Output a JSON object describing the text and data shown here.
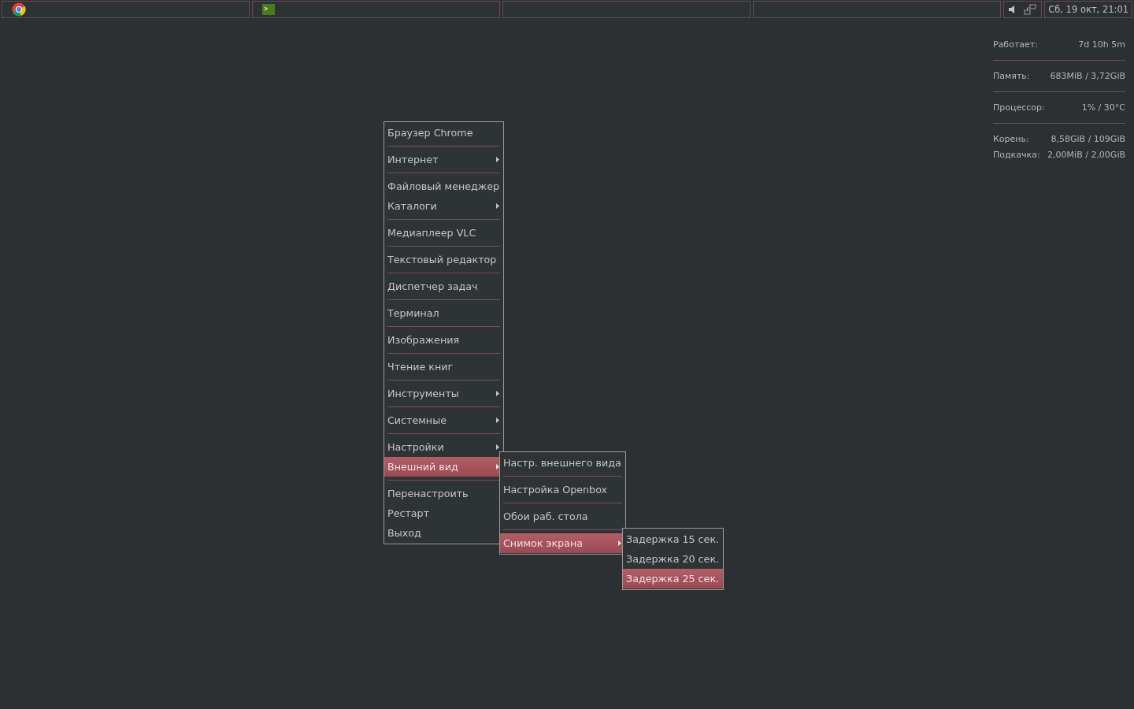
{
  "taskbar": {
    "tasks": [
      {
        "kind": "browser"
      },
      {
        "kind": "terminal"
      },
      {
        "kind": "empty"
      },
      {
        "kind": "empty"
      }
    ],
    "clock": "Сб, 19 окт, 21:01"
  },
  "system_monitor": {
    "rows": [
      {
        "label": "Работает:",
        "value": "7d 10h 5m",
        "divider": true
      },
      {
        "label": "Память:",
        "value": "683MiB / 3,72GiB",
        "divider": true
      },
      {
        "label": "Процессор:",
        "value": "1% /  30°C",
        "divider": true
      },
      {
        "label": "Корень:",
        "value": "8,58GiB /  109GiB",
        "divider": false
      },
      {
        "label": "Подкачка:",
        "value": "2,00MiB / 2,00GiB",
        "divider": false
      }
    ]
  },
  "menus": [
    {
      "items": [
        {
          "kind": "item",
          "label": "Браузер Chrome",
          "submenu": false,
          "selected": false
        },
        {
          "kind": "separator"
        },
        {
          "kind": "item",
          "label": "Интернет",
          "submenu": true,
          "selected": false
        },
        {
          "kind": "separator"
        },
        {
          "kind": "item",
          "label": "Файловый менеджер",
          "submenu": false,
          "selected": false
        },
        {
          "kind": "item",
          "label": "Каталоги",
          "submenu": true,
          "selected": false
        },
        {
          "kind": "separator"
        },
        {
          "kind": "item",
          "label": "Медиаплеер VLC",
          "submenu": false,
          "selected": false
        },
        {
          "kind": "separator"
        },
        {
          "kind": "item",
          "label": "Текстовый редактор",
          "submenu": false,
          "selected": false
        },
        {
          "kind": "separator"
        },
        {
          "kind": "item",
          "label": "Диспетчер задач",
          "submenu": false,
          "selected": false
        },
        {
          "kind": "separator"
        },
        {
          "kind": "item",
          "label": "Терминал",
          "submenu": false,
          "selected": false
        },
        {
          "kind": "separator"
        },
        {
          "kind": "item",
          "label": "Изображения",
          "submenu": false,
          "selected": false
        },
        {
          "kind": "separator"
        },
        {
          "kind": "item",
          "label": "Чтение книг",
          "submenu": false,
          "selected": false
        },
        {
          "kind": "separator"
        },
        {
          "kind": "item",
          "label": "Инструменты",
          "submenu": true,
          "selected": false
        },
        {
          "kind": "separator"
        },
        {
          "kind": "item",
          "label": "Системные",
          "submenu": true,
          "selected": false
        },
        {
          "kind": "separator"
        },
        {
          "kind": "item",
          "label": "Настройки",
          "submenu": true,
          "selected": false
        },
        {
          "kind": "item",
          "label": "Внешний вид",
          "submenu": true,
          "selected": true
        },
        {
          "kind": "separator"
        },
        {
          "kind": "item",
          "label": "Перенастроить",
          "submenu": false,
          "selected": false
        },
        {
          "kind": "item",
          "label": "Рестарт",
          "submenu": false,
          "selected": false
        },
        {
          "kind": "item",
          "label": "Выход",
          "submenu": false,
          "selected": false
        }
      ]
    },
    {
      "items": [
        {
          "kind": "item",
          "label": "Настр. внешнего вида",
          "submenu": false,
          "selected": false
        },
        {
          "kind": "separator"
        },
        {
          "kind": "item",
          "label": "Настройка Openbox",
          "submenu": false,
          "selected": false
        },
        {
          "kind": "separator"
        },
        {
          "kind": "item",
          "label": "Обои раб. стола",
          "submenu": false,
          "selected": false
        },
        {
          "kind": "separator"
        },
        {
          "kind": "item",
          "label": "Снимок экрана",
          "submenu": true,
          "selected": true
        }
      ]
    },
    {
      "items": [
        {
          "kind": "item",
          "label": "Задержка 15 сек.",
          "submenu": false,
          "selected": false
        },
        {
          "kind": "item",
          "label": "Задержка 20 сек.",
          "submenu": false,
          "selected": false
        },
        {
          "kind": "item",
          "label": "Задержка 25 сек.",
          "submenu": false,
          "selected": true
        }
      ]
    }
  ]
}
